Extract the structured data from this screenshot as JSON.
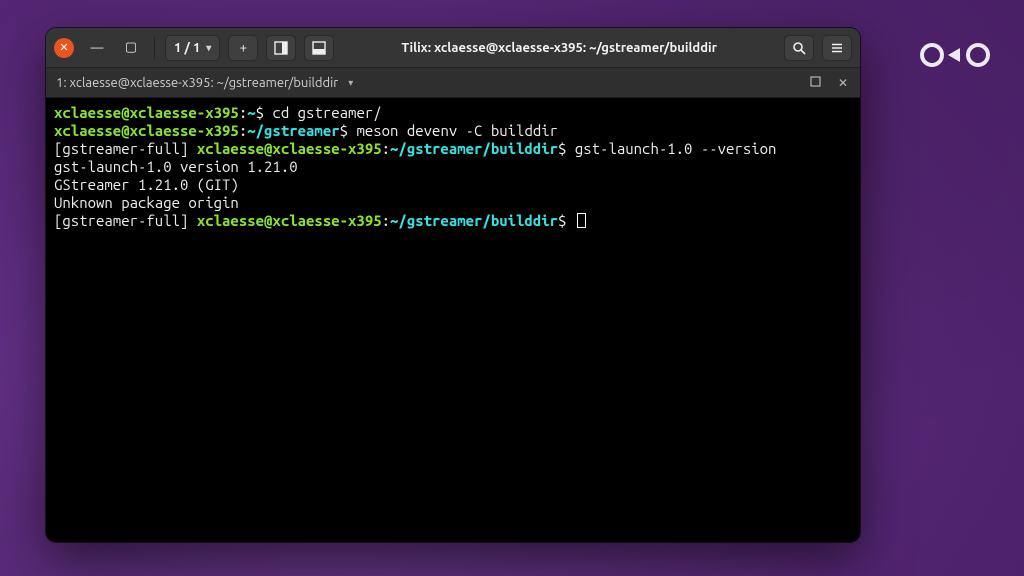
{
  "window": {
    "title": "Tilix: xclaesse@xclaesse-x395: ~/gstreamer/builddir",
    "session_counter": "1 / 1"
  },
  "tab": {
    "label": "1: xclaesse@xclaesse-x395: ~/gstreamer/builddir"
  },
  "terminal": {
    "lines": [
      {
        "prefix": "",
        "user": "xclaesse@xclaesse-x395",
        "sep": ":",
        "path": "~",
        "dollar": "$ ",
        "cmd": "cd gstreamer/"
      },
      {
        "prefix": "",
        "user": "xclaesse@xclaesse-x395",
        "sep": ":",
        "path": "~/gstreamer",
        "dollar": "$ ",
        "cmd": "meson devenv -C builddir"
      },
      {
        "prefix": "[gstreamer-full] ",
        "user": "xclaesse@xclaesse-x395",
        "sep": ":",
        "path": "~/gstreamer/builddir",
        "dollar": "$ ",
        "cmd": "gst-launch-1.0 --version"
      },
      {
        "plain": "gst-launch-1.0 version 1.21.0"
      },
      {
        "plain": "GStreamer 1.21.0 (GIT)"
      },
      {
        "plain": "Unknown package origin"
      },
      {
        "prefix": "[gstreamer-full] ",
        "user": "xclaesse@xclaesse-x395",
        "sep": ":",
        "path": "~/gstreamer/builddir",
        "dollar": "$ ",
        "cmd": "",
        "cursor": true
      }
    ]
  },
  "icons": {
    "close": "✕",
    "minimize": "—",
    "maximize": "▢",
    "plus": "+",
    "split_down": "⇲",
    "split_right": "⇱",
    "search": "⌕",
    "hamburger": "≡",
    "chevron": "▾",
    "tab_max": "▫",
    "tab_close": "✕"
  }
}
